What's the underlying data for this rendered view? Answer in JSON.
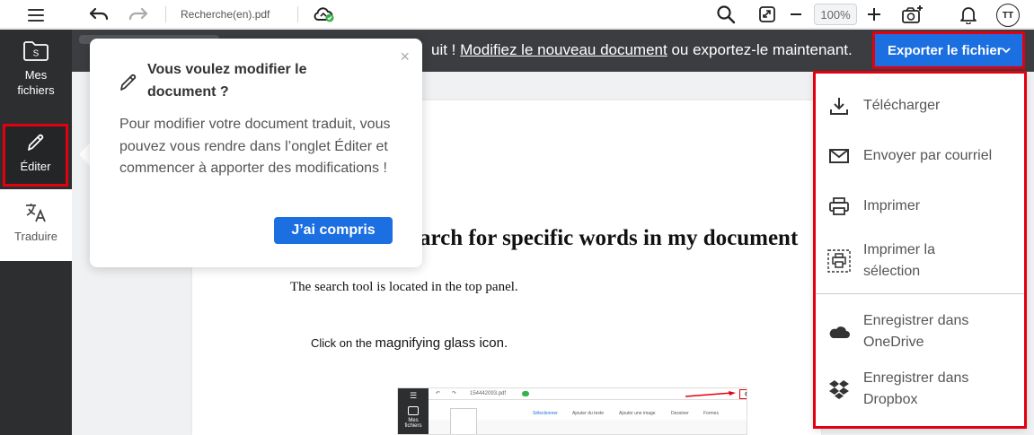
{
  "toolbar": {
    "file_name": "Recherche(en).pdf",
    "zoom": "100%",
    "avatar_initials": "TT",
    "icons": [
      "menu-icon",
      "undo-icon",
      "redo-icon",
      "cloud-sync-icon",
      "search-icon",
      "fullscreen-icon",
      "zoom-out-icon",
      "zoom-in-icon",
      "add-image-icon",
      "notification-bell-icon"
    ]
  },
  "notification": {
    "text_prefix": "uit !",
    "link_text": "Modifiez le nouveau document",
    "text_suffix": "ou exportez-le maintenant.",
    "export_button": "Exporter le fichier"
  },
  "sidebar": {
    "items": [
      {
        "label_line1": "Mes",
        "label_line2": "fichiers",
        "icon": "folder-icon"
      },
      {
        "label": "Éditer",
        "icon": "pencil-icon"
      },
      {
        "label": "Traduire",
        "icon": "translate-icon"
      }
    ]
  },
  "popover": {
    "title": "Vous voulez modifier le document ?",
    "body": "Pour modifier votre document traduit, vous pouvez vous rendre dans l’onglet Éditer et commencer à apporter des modifications !",
    "button": "J’ai compris",
    "close": "×"
  },
  "document": {
    "heading": "Search for specific words in my document",
    "paragraph1": "The search tool is located in the top panel.",
    "paragraph2_prefix": "Click on the",
    "paragraph2_emph": "magnifying glass icon.",
    "embedded_screenshot": {
      "file_name": "154442093.pdf",
      "sidebar_label_1": "Mes",
      "sidebar_label_2": "fichiers",
      "tools": [
        "Sélectionner",
        "Ajouter du texte",
        "Ajouter une image",
        "Dessiner",
        "Formes"
      ]
    }
  },
  "dropdown": {
    "items": [
      {
        "label": "Télécharger",
        "icon": "download-icon"
      },
      {
        "label": "Envoyer par courriel",
        "icon": "mail-icon"
      },
      {
        "label": "Imprimer",
        "icon": "printer-icon"
      },
      {
        "label_line1": "Imprimer la",
        "label_line2": "sélection",
        "icon": "print-selection-icon"
      },
      {
        "label_line1": "Enregistrer dans",
        "label_line2": "OneDrive",
        "icon": "onedrive-icon"
      },
      {
        "label_line1": "Enregistrer dans",
        "label_line2": "Dropbox",
        "icon": "dropbox-icon"
      }
    ]
  },
  "colors": {
    "accent_blue": "#1b6fe0",
    "highlight_red": "#e3000f",
    "dark_bar": "#3b3d40",
    "sidebar": "#2c2e30"
  }
}
